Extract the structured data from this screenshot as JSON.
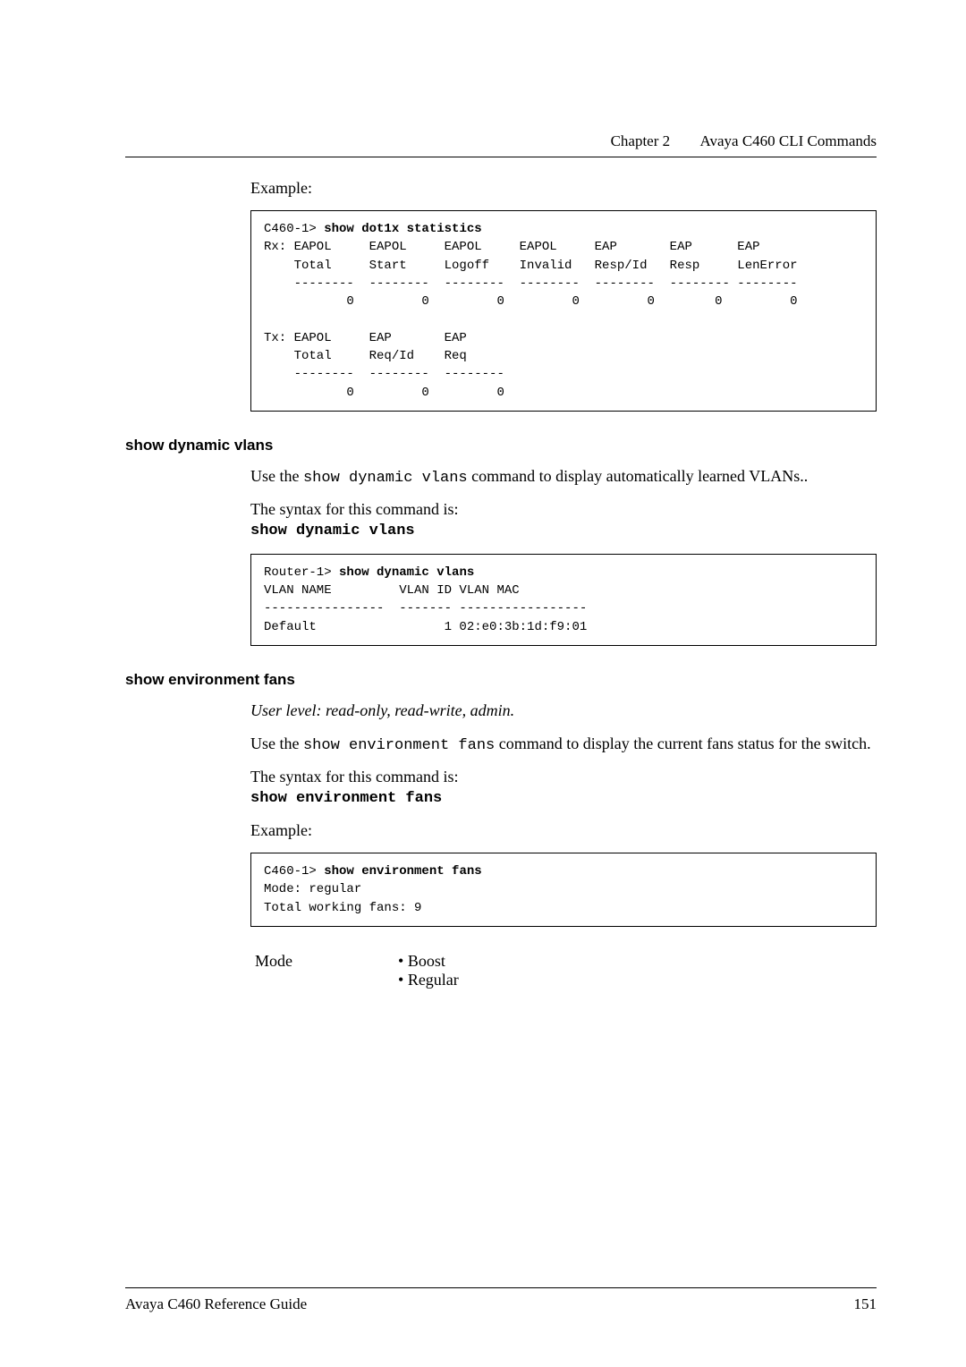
{
  "header": {
    "chapter": "Chapter 2",
    "title": "Avaya C460 CLI Commands"
  },
  "example_label": "Example:",
  "code_block_1": {
    "prompt": "C460-1> ",
    "command": "show dot1x statistics",
    "body": "Rx: EAPOL     EAPOL     EAPOL     EAPOL     EAP       EAP      EAP\n    Total     Start     Logoff    Invalid   Resp/Id   Resp     LenError\n    --------  --------  --------  --------  --------  -------- --------\n           0         0         0         0         0        0         0\n\nTx: EAPOL     EAP       EAP\n    Total     Req/Id    Req\n    --------  --------  --------\n           0         0         0"
  },
  "section1": {
    "heading": "show dynamic vlans",
    "para1_pre": "Use the ",
    "para1_cmd": "show dynamic vlans",
    "para1_post": " command to display automatically learned VLANs..",
    "syntax_label": "The syntax for this command is:",
    "syntax_cmd": "show dynamic vlans"
  },
  "code_block_2": {
    "prompt": "Router-1> ",
    "command": "show dynamic vlans",
    "body": "VLAN NAME         VLAN ID VLAN MAC\n----------------  ------- -----------------\nDefault                 1 02:e0:3b:1d:f9:01"
  },
  "section2": {
    "heading": "show environment fans",
    "user_level": "User level: read-only, read-write, admin.",
    "para1_pre": "Use the ",
    "para1_cmd": "show environment fans",
    "para1_post": " command to display the current fans status for the switch.",
    "syntax_label": "The syntax for this command is:",
    "syntax_cmd": "show environment fans",
    "example_label": "Example:"
  },
  "code_block_3": {
    "prompt": "C460-1> ",
    "command": "show environment fans",
    "body": "Mode: regular\nTotal working fans: 9"
  },
  "mode": {
    "label": "Mode",
    "items": [
      "Boost",
      "Regular"
    ]
  },
  "footer": {
    "left": "Avaya C460 Reference Guide",
    "right": "151"
  }
}
